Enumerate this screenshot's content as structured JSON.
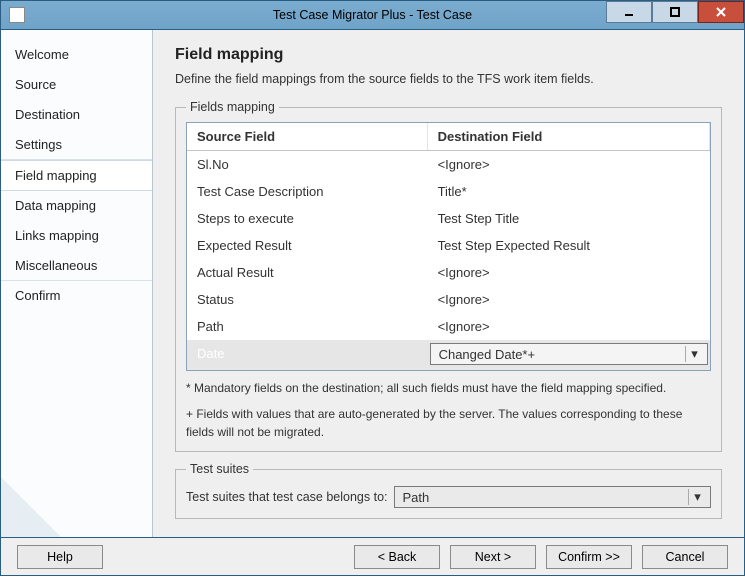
{
  "window": {
    "title": "Test Case Migrator Plus - Test Case"
  },
  "sidebar": {
    "items": [
      {
        "label": "Welcome"
      },
      {
        "label": "Source"
      },
      {
        "label": "Destination"
      },
      {
        "label": "Settings"
      },
      {
        "label": "Field mapping",
        "active": true
      },
      {
        "label": "Data mapping"
      },
      {
        "label": "Links mapping"
      },
      {
        "label": "Miscellaneous"
      },
      {
        "label": "Confirm"
      }
    ]
  },
  "main": {
    "heading": "Field mapping",
    "description": "Define the field mappings from the source fields to the TFS work item fields.",
    "fields_legend": "Fields mapping",
    "columns": {
      "source": "Source Field",
      "destination": "Destination Field"
    },
    "rows": [
      {
        "src": "Sl.No",
        "dst": "<Ignore>"
      },
      {
        "src": "Test Case Description",
        "dst": "Title*"
      },
      {
        "src": "Steps to execute",
        "dst": "Test Step Title"
      },
      {
        "src": "Expected Result",
        "dst": "Test Step Expected Result"
      },
      {
        "src": "Actual Result",
        "dst": "<Ignore>"
      },
      {
        "src": "Status",
        "dst": "<Ignore>"
      },
      {
        "src": "Path",
        "dst": "<Ignore>"
      }
    ],
    "editing_row": {
      "src": "Date",
      "dst": "Changed Date*+"
    },
    "note_mandatory": "* Mandatory fields on the destination; all such fields must have the field mapping specified.",
    "note_autogen": "+ Fields with values that are auto-generated by the server. The values corresponding to these fields will not be migrated.",
    "suites_legend": "Test suites",
    "suites_label": "Test suites that test case belongs to:",
    "suites_value": "Path"
  },
  "footer": {
    "help": "Help",
    "back": "< Back",
    "next": "Next >",
    "confirm": "Confirm >>",
    "cancel": "Cancel"
  }
}
